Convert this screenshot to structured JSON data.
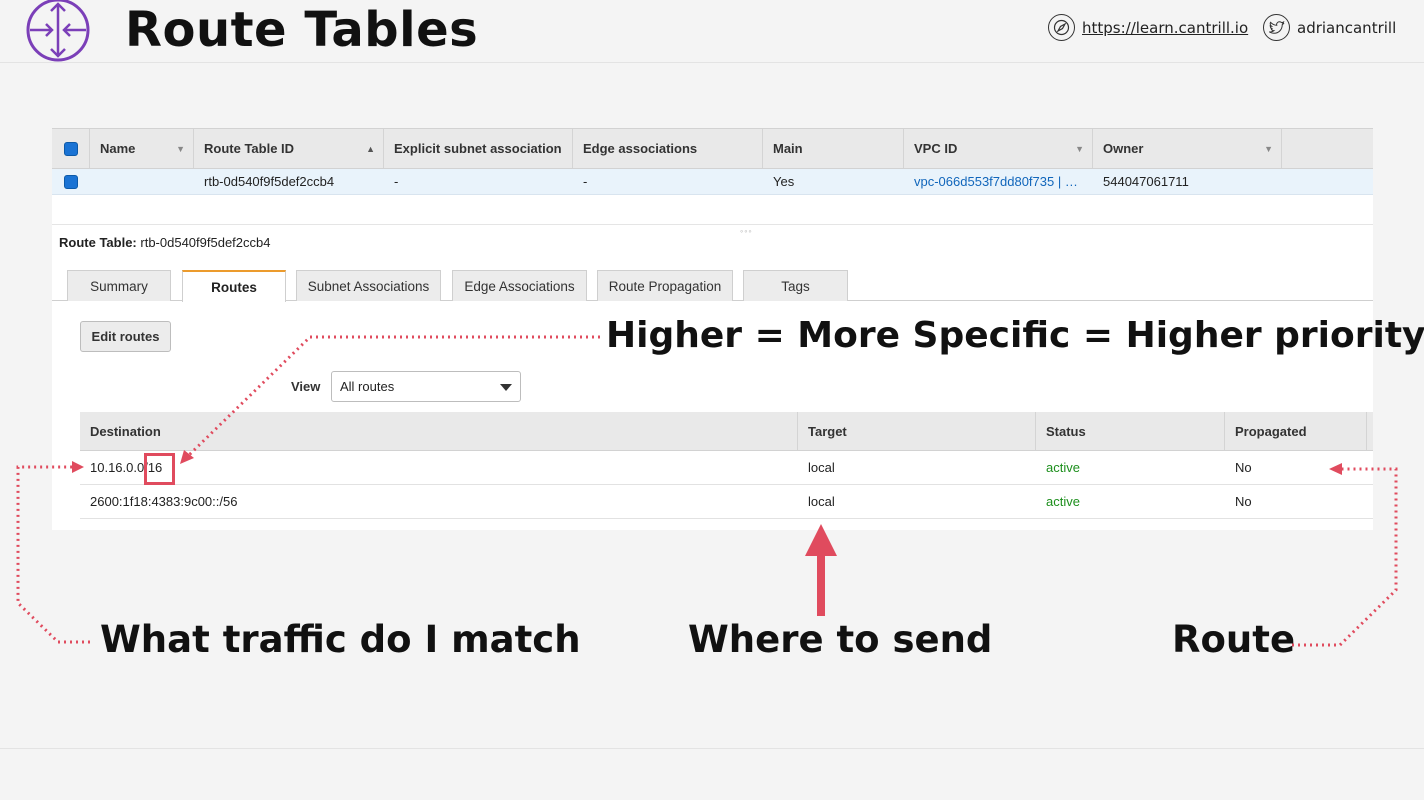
{
  "slide": {
    "title": "Route Tables",
    "site_link": "https://learn.cantrill.io",
    "twitter_handle": "adriancantrill"
  },
  "grid": {
    "columns": [
      "Name",
      "Route Table ID",
      "Explicit subnet association",
      "Edge associations",
      "Main",
      "VPC ID",
      "Owner"
    ],
    "row": {
      "name": "",
      "route_table_id": "rtb-0d540f9f5def2ccb4",
      "explicit_subnet": "-",
      "edge_assoc": "-",
      "main": "Yes",
      "vpc_id": "vpc-066d553f7dd80f735 | …",
      "owner": "544047061711"
    }
  },
  "detail": {
    "label": "Route Table:",
    "value": "rtb-0d540f9f5def2ccb4",
    "tabs": [
      "Summary",
      "Routes",
      "Subnet Associations",
      "Edge Associations",
      "Route Propagation",
      "Tags"
    ],
    "active_tab": "Routes",
    "edit_button": "Edit routes",
    "view_label": "View",
    "view_value": "All routes"
  },
  "routes": {
    "columns": [
      "Destination",
      "Target",
      "Status",
      "Propagated"
    ],
    "rows": [
      {
        "destination": "10.16.0.0/16",
        "target": "local",
        "status": "active",
        "propagated": "No"
      },
      {
        "destination": "2600:1f18:4383:9c00::/56",
        "target": "local",
        "status": "active",
        "propagated": "No"
      }
    ]
  },
  "annotations": {
    "priority": "Higher = More Specific = Higher priority",
    "match": "What traffic do I match",
    "send": "Where to send",
    "route": "Route"
  },
  "colors": {
    "accent": "#7b3fb8",
    "arrow": "#e04b5e",
    "active_tab": "#ec9b2d",
    "status_active": "#1d8f1d",
    "link": "#1166bb"
  }
}
